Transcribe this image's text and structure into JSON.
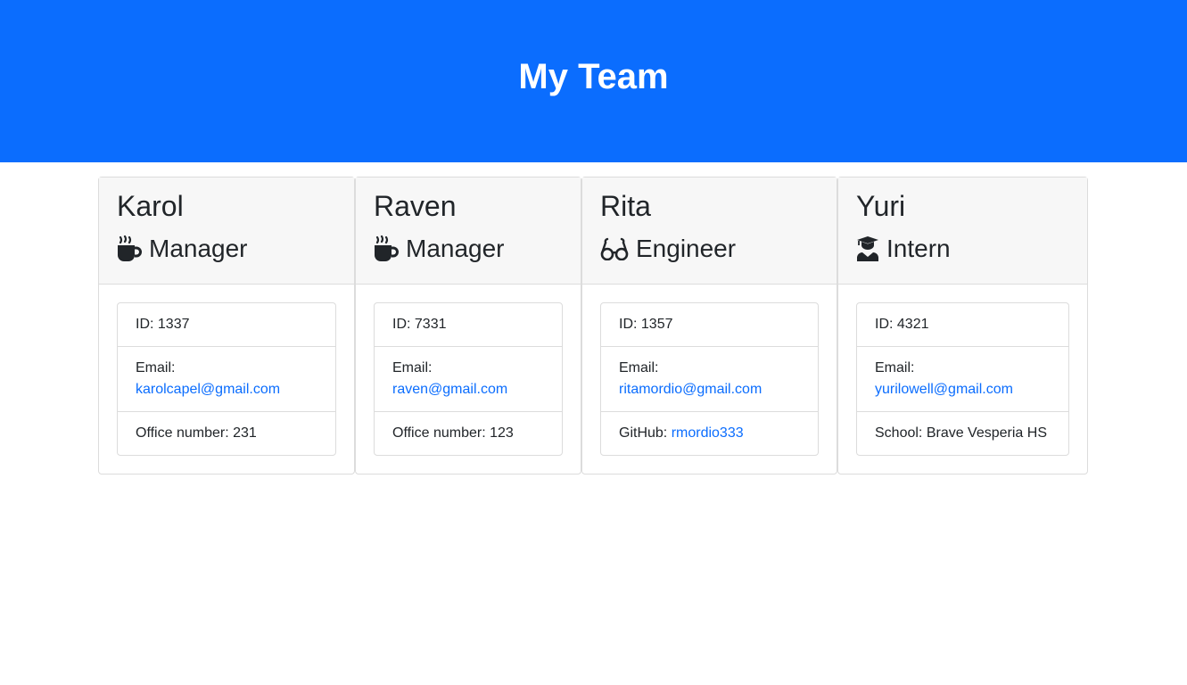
{
  "header": {
    "title": "My Team"
  },
  "colors": {
    "header_bg": "#0b6dfe",
    "link": "#0b6dfe"
  },
  "cards": [
    {
      "name": "Karol",
      "role": "Manager",
      "icon": "coffee-mug-icon",
      "id_text": "ID: 1337",
      "email_label": "Email:",
      "email": "karolcapel@gmail.com",
      "extra_label": "Office number: 231",
      "extra_link": ""
    },
    {
      "name": "Raven",
      "role": "Manager",
      "icon": "coffee-mug-icon",
      "id_text": "ID: 7331",
      "email_label": "Email:",
      "email": "raven@gmail.com",
      "extra_label": "Office number: 123",
      "extra_link": ""
    },
    {
      "name": "Rita",
      "role": "Engineer",
      "icon": "glasses-icon",
      "id_text": "ID: 1357",
      "email_label": "Email:",
      "email": "ritamordio@gmail.com",
      "extra_label": "GitHub: ",
      "extra_link": "rmordio333"
    },
    {
      "name": "Yuri",
      "role": "Intern",
      "icon": "graduate-icon",
      "id_text": "ID: 4321",
      "email_label": "Email:",
      "email": "yurilowell@gmail.com",
      "extra_label": "School: Brave Vesperia HS",
      "extra_link": ""
    }
  ]
}
